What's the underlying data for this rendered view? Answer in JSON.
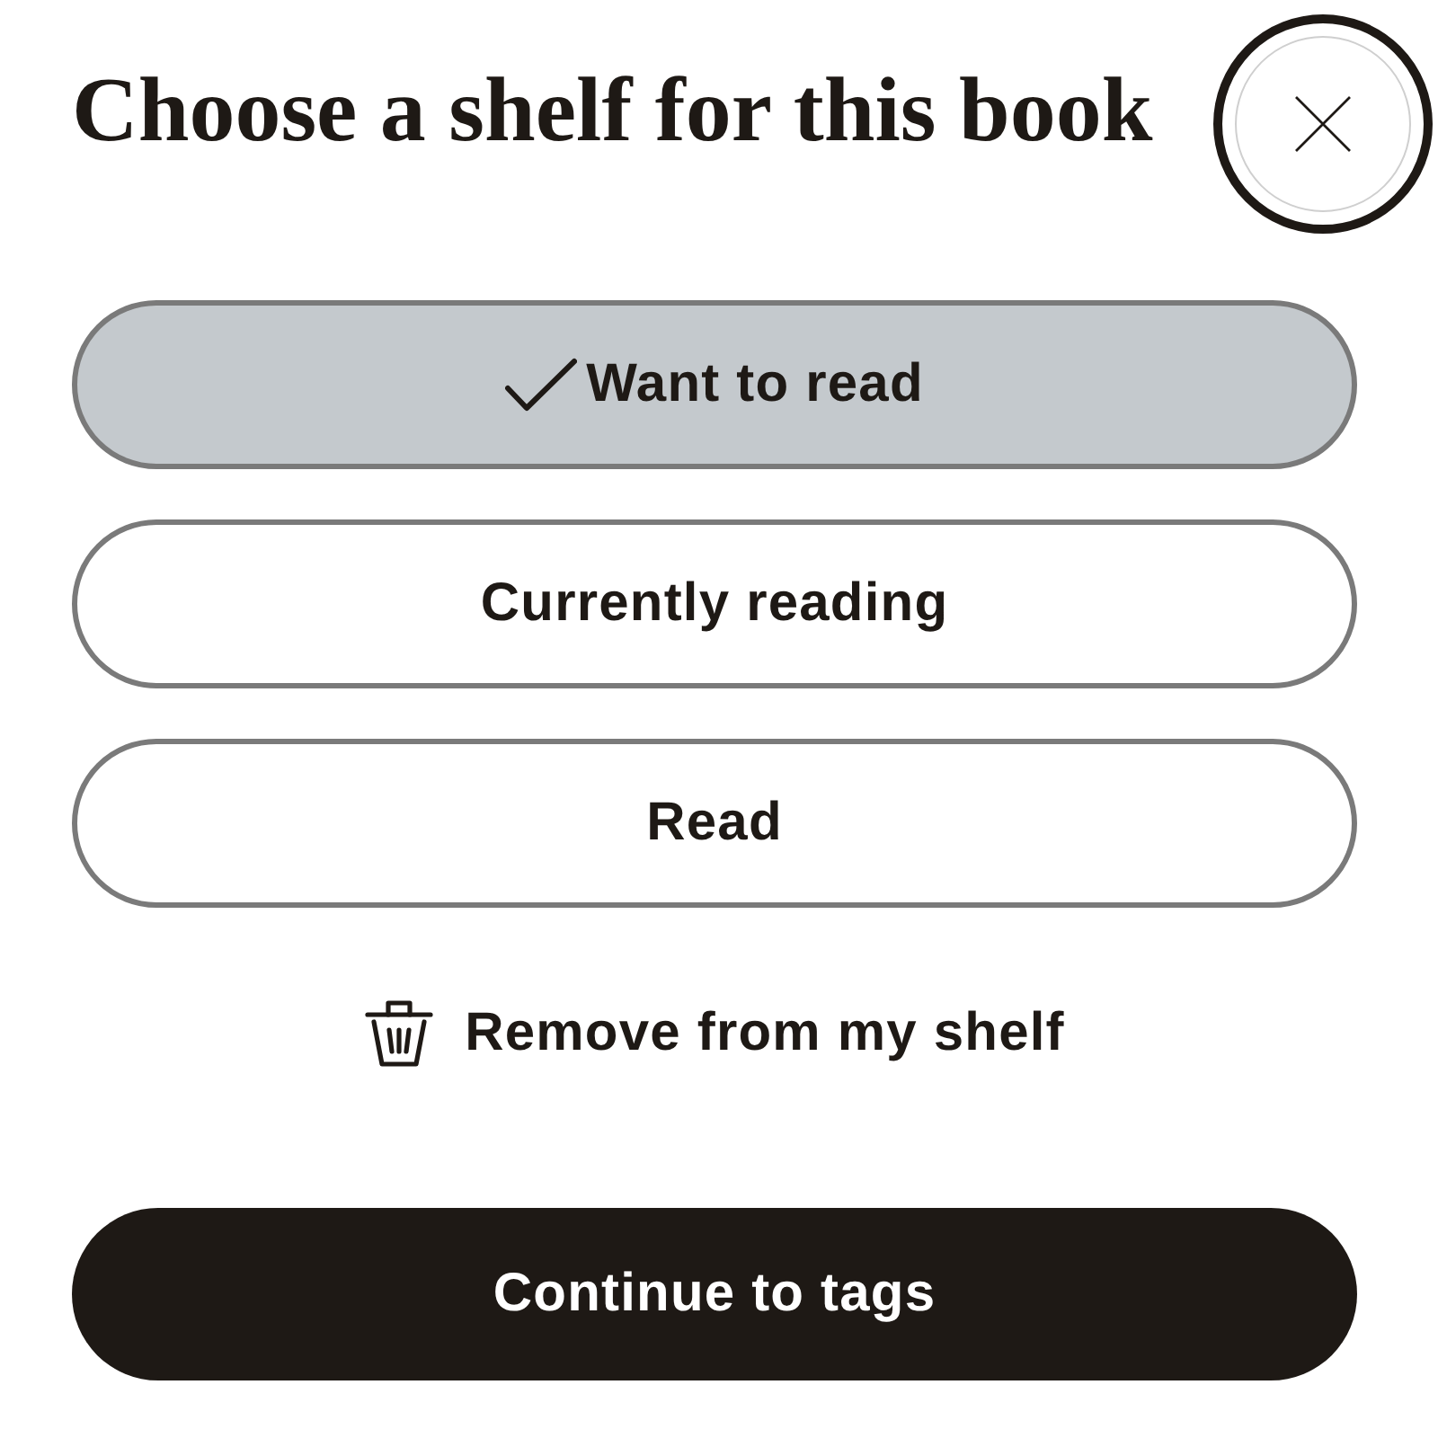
{
  "dialog": {
    "title": "Choose a shelf for this book"
  },
  "shelves": [
    {
      "label": "Want to read",
      "selected": true
    },
    {
      "label": "Currently reading",
      "selected": false
    },
    {
      "label": "Read",
      "selected": false
    }
  ],
  "remove_action": {
    "label": "Remove from my shelf"
  },
  "continue_button": {
    "label": "Continue to tags"
  }
}
